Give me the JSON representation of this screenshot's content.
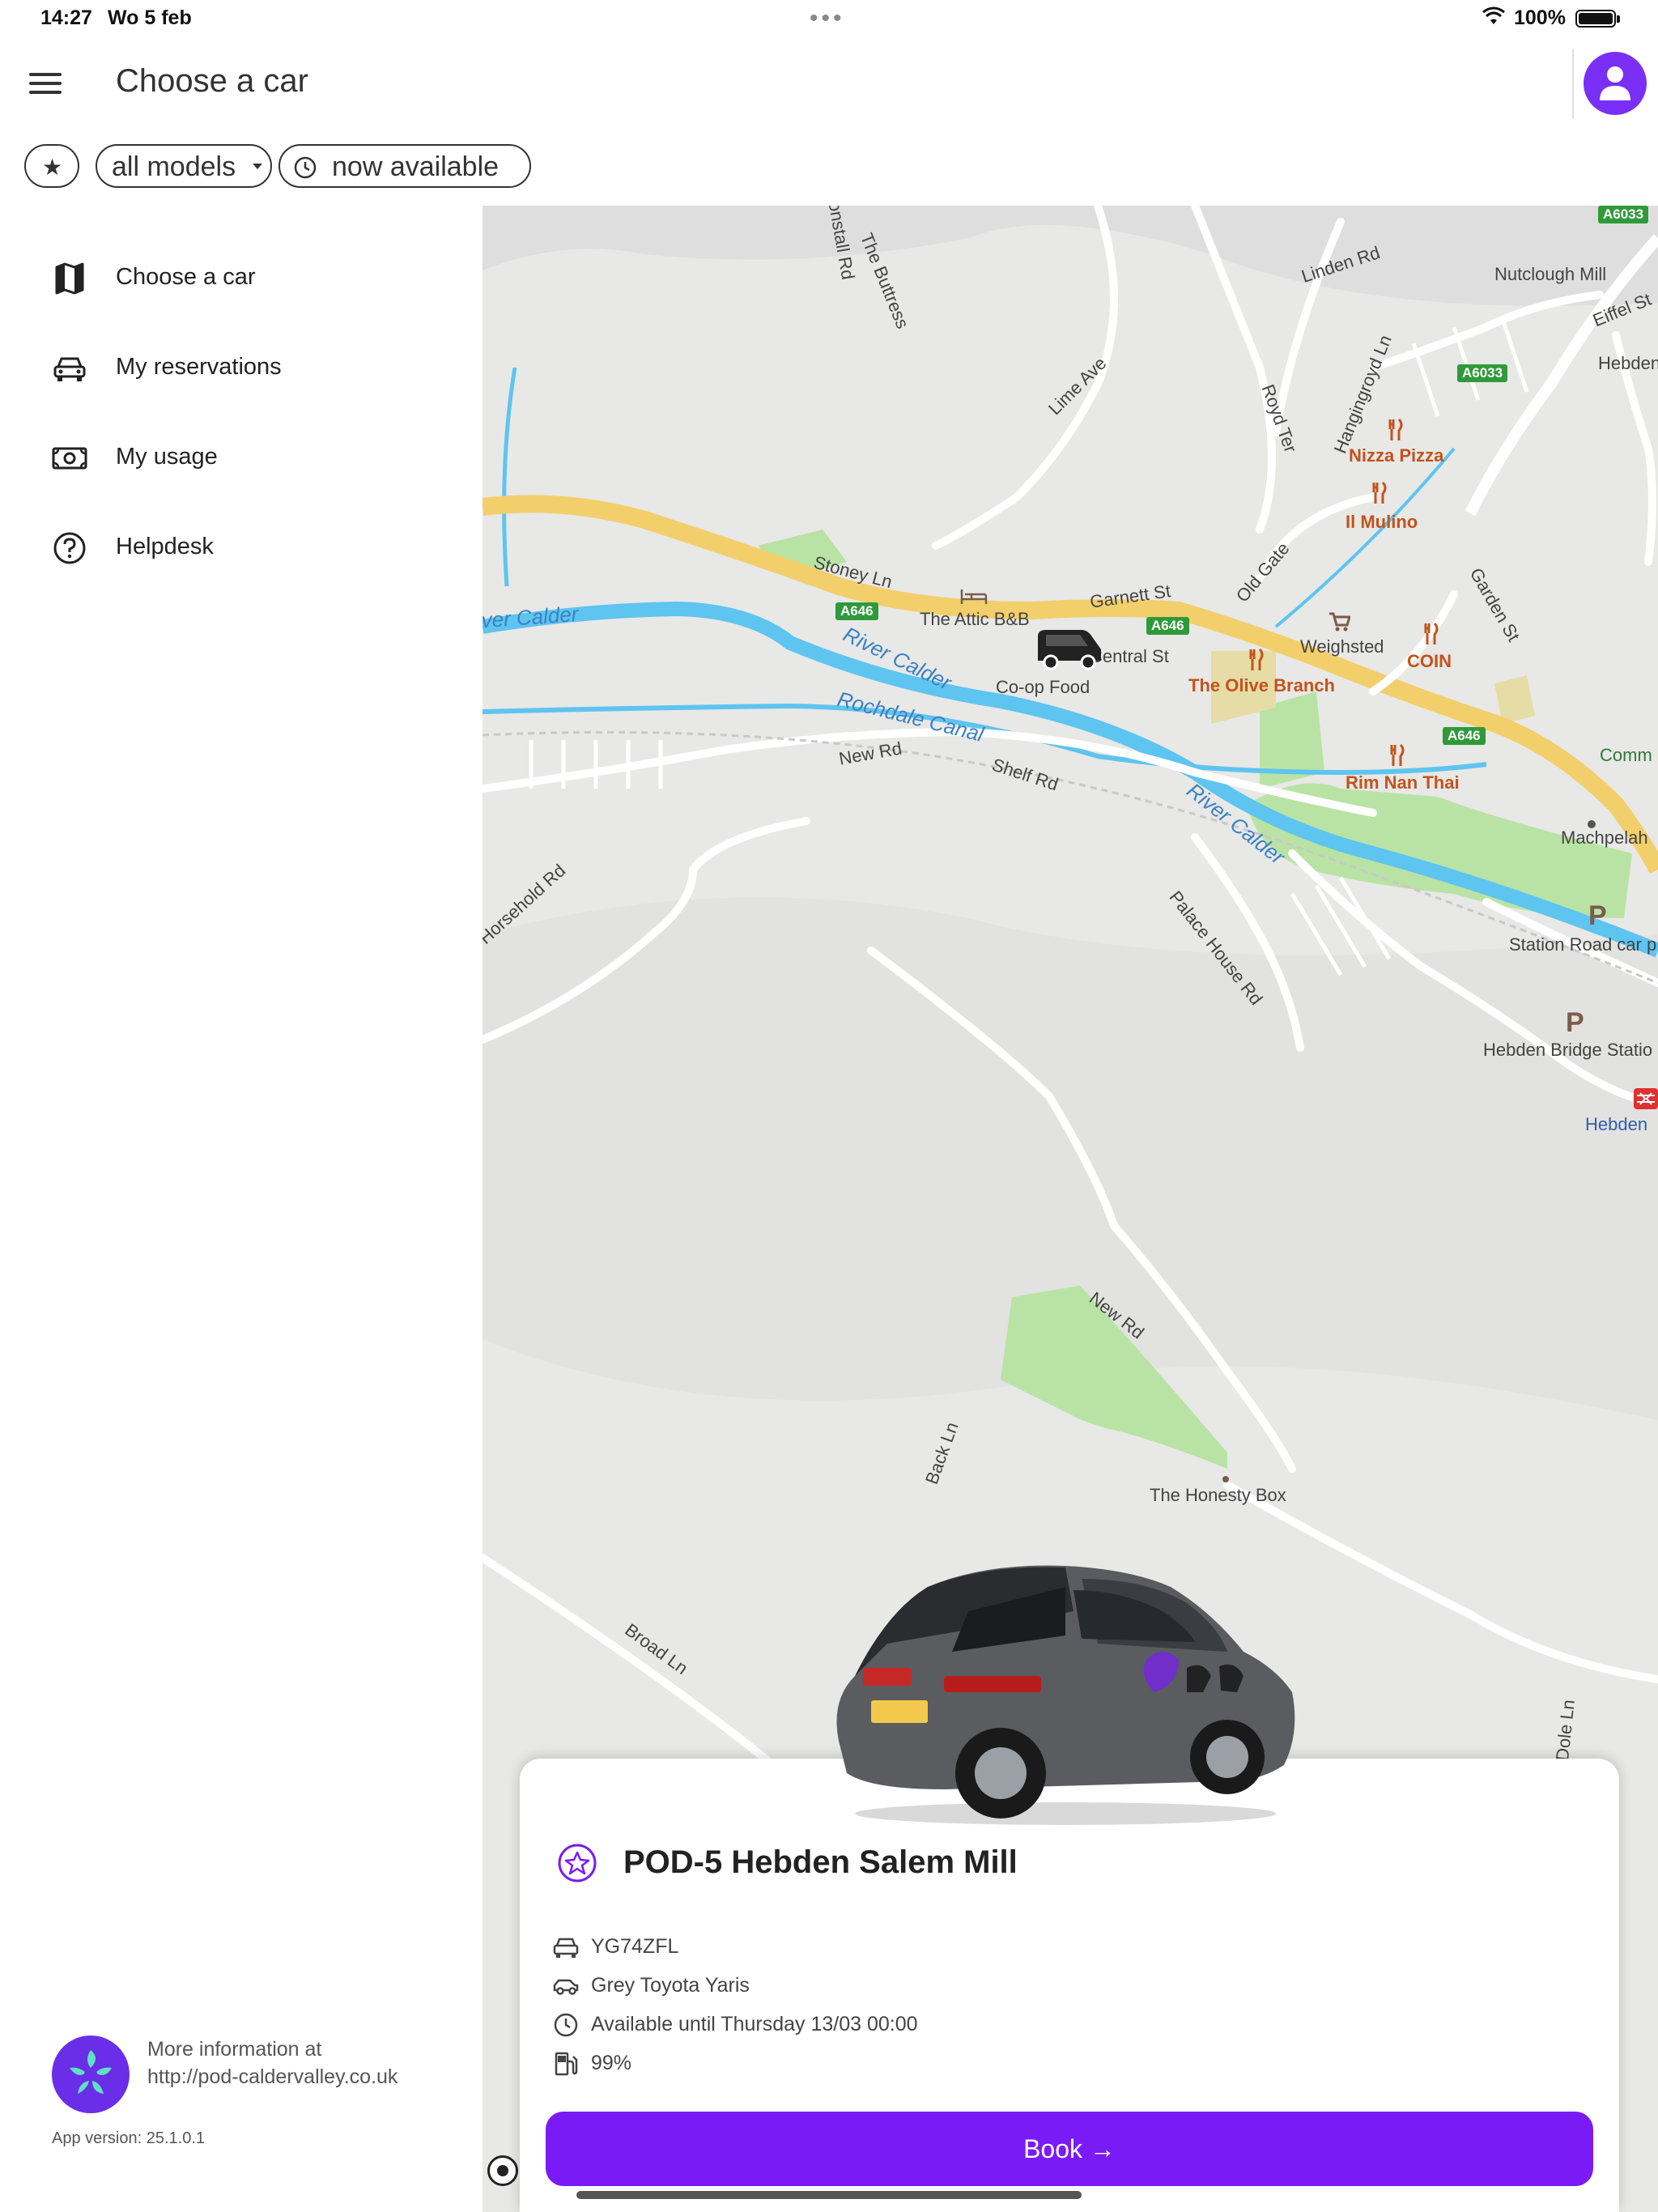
{
  "status_bar": {
    "time": "14:27",
    "date": "Wo 5 feb",
    "battery": "100%"
  },
  "header": {
    "title": "Choose a car"
  },
  "filters": {
    "models": "all models",
    "availability": "now available"
  },
  "sidebar": {
    "items": [
      {
        "label": "Choose a car",
        "icon": "map-icon"
      },
      {
        "label": "My reservations",
        "icon": "car-icon"
      },
      {
        "label": "My usage",
        "icon": "money-icon"
      },
      {
        "label": "Helpdesk",
        "icon": "help-icon"
      }
    ],
    "footer": {
      "info_line1": "More information at",
      "info_line2": "http://pod-caldervalley.co.uk",
      "app_version": "App version: 25.1.0.1"
    }
  },
  "map": {
    "labels": {
      "linden_rd": "Linden Rd",
      "nutclough_mill": "Nutclough Mill",
      "eiffel_st": "Eiffel St",
      "hebden": "Hebden",
      "the_buttress": "The Buttress",
      "lime_ave": "Lime Ave",
      "royd_ter": "Royd Ter",
      "hangingroyd_ln": "Hangingroyd Ln",
      "nizza_pizza": "Nizza Pizza",
      "il_mulino": "Il Mulino",
      "old_gate": "Old Gate",
      "garden_st": "Garden St",
      "stoney_ln": "Stoney Ln",
      "attic_bb": "The Attic B&B",
      "garnett_st": "Garnett St",
      "river_calder_1": "River Calder",
      "river_calder_2": "River Calder",
      "river_calder_3": "River Calder",
      "central_st": "Central St",
      "coop_food": "Co-op Food",
      "weighsted": "Weighsted",
      "coin": "COIN",
      "olive_branch": "The Olive Branch",
      "rochdale_canal": "Rochdale Canal",
      "new_rd": "New Rd",
      "shelf_rd": "Shelf Rd",
      "rim_nan_thai": "Rim Nan Thai",
      "commercial": "Comm",
      "machpelah": "Machpelah",
      "horsehold_rd": "Horsehold Rd",
      "palace_house_rd": "Palace House Rd",
      "station_road_car": "Station Road car p",
      "hebden_bridge_station": "Hebden Bridge Statio",
      "hebden_2": "Hebden",
      "new_rd_2": "New Rd",
      "back_ln": "Back Ln",
      "honesty_box": "The Honesty Box",
      "broad_ln": "Broad Ln",
      "dole_ln": "Dole Ln",
      "heptonstall_rd": "onstall Rd"
    },
    "road_badges": {
      "a6033_1": "A6033",
      "a6033_2": "A6033",
      "a646_1": "A646",
      "a646_2": "A646",
      "a646_3": "A646"
    }
  },
  "car_card": {
    "title": "POD-5 Hebden Salem Mill",
    "plate": "YG74ZFL",
    "model": "Grey Toyota Yaris",
    "availability": "Available until Thursday 13/03 00:00",
    "fuel": "99%",
    "book_label": "Book →"
  },
  "colors": {
    "accent": "#7a1bf5",
    "road_major": "#f2cf6b",
    "water": "#5ec4f0",
    "park": "#b9e3a4"
  }
}
